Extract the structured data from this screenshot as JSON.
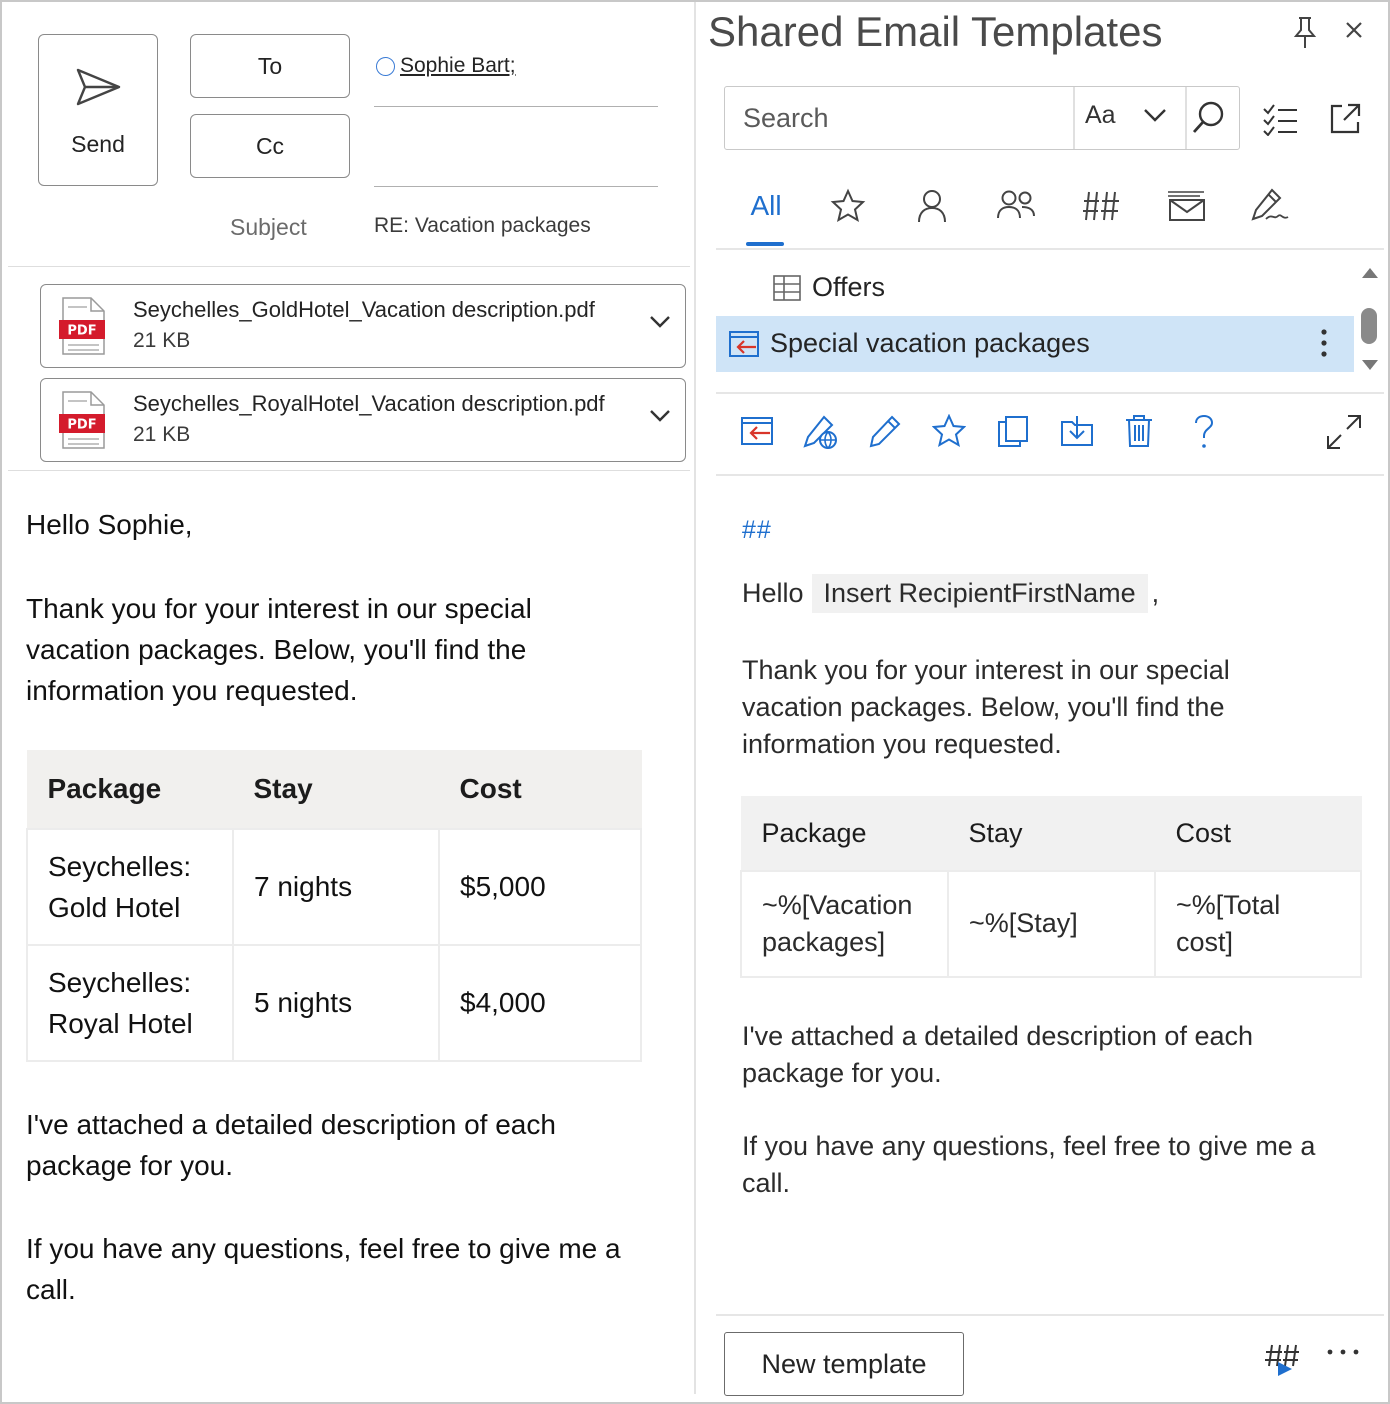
{
  "compose": {
    "send_label": "Send",
    "to_label": "To",
    "cc_label": "Cc",
    "recipient": "Sophie Bart;",
    "subject_label": "Subject",
    "subject_value": "RE: Vacation packages",
    "attachments": [
      {
        "name": "Seychelles_GoldHotel_Vacation description.pdf",
        "size": "21 KB",
        "badge": "PDF"
      },
      {
        "name": "Seychelles_RoyalHotel_Vacation description.pdf",
        "size": "21 KB",
        "badge": "PDF"
      }
    ],
    "greeting": "Hello Sophie,",
    "intro": "Thank you for your interest in our special vacation packages. Below, you'll find the information you requested.",
    "table": {
      "headers": [
        "Package",
        "Stay",
        "Cost"
      ],
      "rows": [
        [
          "Seychelles: Gold Hotel",
          "7 nights",
          "$5,000"
        ],
        [
          "Seychelles: Royal Hotel",
          "5 nights",
          "$4,000"
        ]
      ]
    },
    "attached_note": "I've attached a detailed description of each package for you.",
    "closing": "If you have any questions, feel free to give me a call."
  },
  "pane": {
    "title": "Shared Email Templates",
    "search_placeholder": "Search",
    "match_case": "Aa",
    "tab_all": "All",
    "tree": [
      {
        "label": "Offers",
        "icon": "folder-table-icon"
      },
      {
        "label": "Special vacation packages",
        "icon": "insert-template-icon",
        "selected": true
      }
    ],
    "preview": {
      "marker": "##",
      "hello": "Hello",
      "placeholder": "Insert RecipientFirstName",
      "comma": ",",
      "intro": "Thank you for your interest in our special vacation packages. Below, you'll find the information you requested.",
      "table": {
        "headers": [
          "Package",
          "Stay",
          "Cost"
        ],
        "row": [
          "~%[Vacation packages]",
          "~%[Stay]",
          "~%[Total cost]"
        ]
      },
      "attached_note": "I've attached a detailed description of each package for you.",
      "closing": "If you have any questions, feel free to give me a call."
    },
    "new_template_label": "New template",
    "accent": "#1f6fce",
    "selection": "#cfe4f7"
  }
}
